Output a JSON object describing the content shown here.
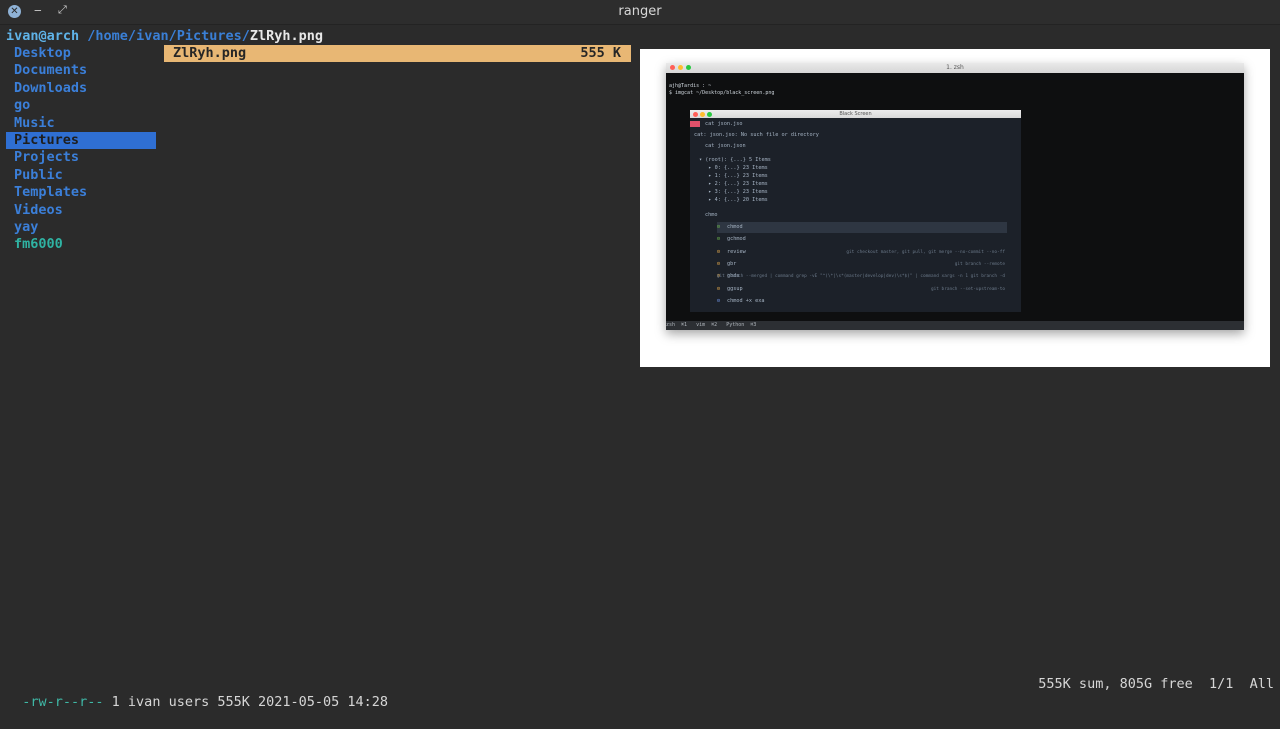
{
  "window": {
    "title": "ranger",
    "close_glyph": "✕",
    "minimize_glyph": "‒",
    "maximize_glyph": "⤢"
  },
  "ranger": {
    "host": "ivan@arch",
    "path": "/home/ivan/Pictures/",
    "file": "ZlRyh.png",
    "parent_dirs": [
      {
        "label": "Desktop",
        "selected": false
      },
      {
        "label": "Documents",
        "selected": false
      },
      {
        "label": "Downloads",
        "selected": false
      },
      {
        "label": "go",
        "selected": false
      },
      {
        "label": "Music",
        "selected": false
      },
      {
        "label": "Pictures",
        "selected": true
      },
      {
        "label": "Projects",
        "selected": false
      },
      {
        "label": "Public",
        "selected": false
      },
      {
        "label": "Templates",
        "selected": false
      },
      {
        "label": "Videos",
        "selected": false
      },
      {
        "label": "yay",
        "selected": false
      },
      {
        "label": "fm6000",
        "selected": false
      }
    ],
    "current_file": {
      "name": "ZlRyh.png",
      "size": "555 K"
    },
    "status": {
      "permissions": "-rw-r--r--",
      "meta": " 1 ivan users 555K 2021-05-05 14:28",
      "summary": "555K sum, 805G free  1/1  All"
    }
  },
  "preview": {
    "terminal_title": "1. zsh",
    "lines": [
      "ajh@Tardis : ~",
      "$ imgcat ~/Desktop/black_screen.png"
    ],
    "inner_title": "Black Screen",
    "inner_lines": [
      "cat json.jso",
      "cat: json.jso: No such file or directory",
      "cat json.json",
      "▾ (root): {...} 5 Items",
      "   ▸ 0: {...} 23 Items",
      "   ▸ 1: {...} 23 Items",
      "   ▸ 2: {...} 23 Items",
      "   ▸ 3: {...} 23 Items",
      "   ▸ 4: {...} 20 Items",
      "chmo"
    ],
    "suggestions": [
      {
        "name": "chmod",
        "desc": ""
      },
      {
        "name": "gchmod",
        "desc": ""
      },
      {
        "name": "review",
        "desc": "git checkout master, git pull, git merge --no-commit --no-ff"
      },
      {
        "name": "gbr",
        "desc": "git branch --remote"
      },
      {
        "name": "gbda",
        "desc": "git branch --merged | command grep -vE \"^(\\*|\\s*(master|develop|dev)\\s*$)\" | command xargs -n 1 git branch -d"
      },
      {
        "name": "ggsup",
        "desc": "git branch --set-upstream-to"
      },
      {
        "name": "chmod +x exa",
        "desc": ""
      }
    ],
    "status_tabs": "zsh  ⌘1   vim  ⌘2   Python  ⌘3"
  }
}
